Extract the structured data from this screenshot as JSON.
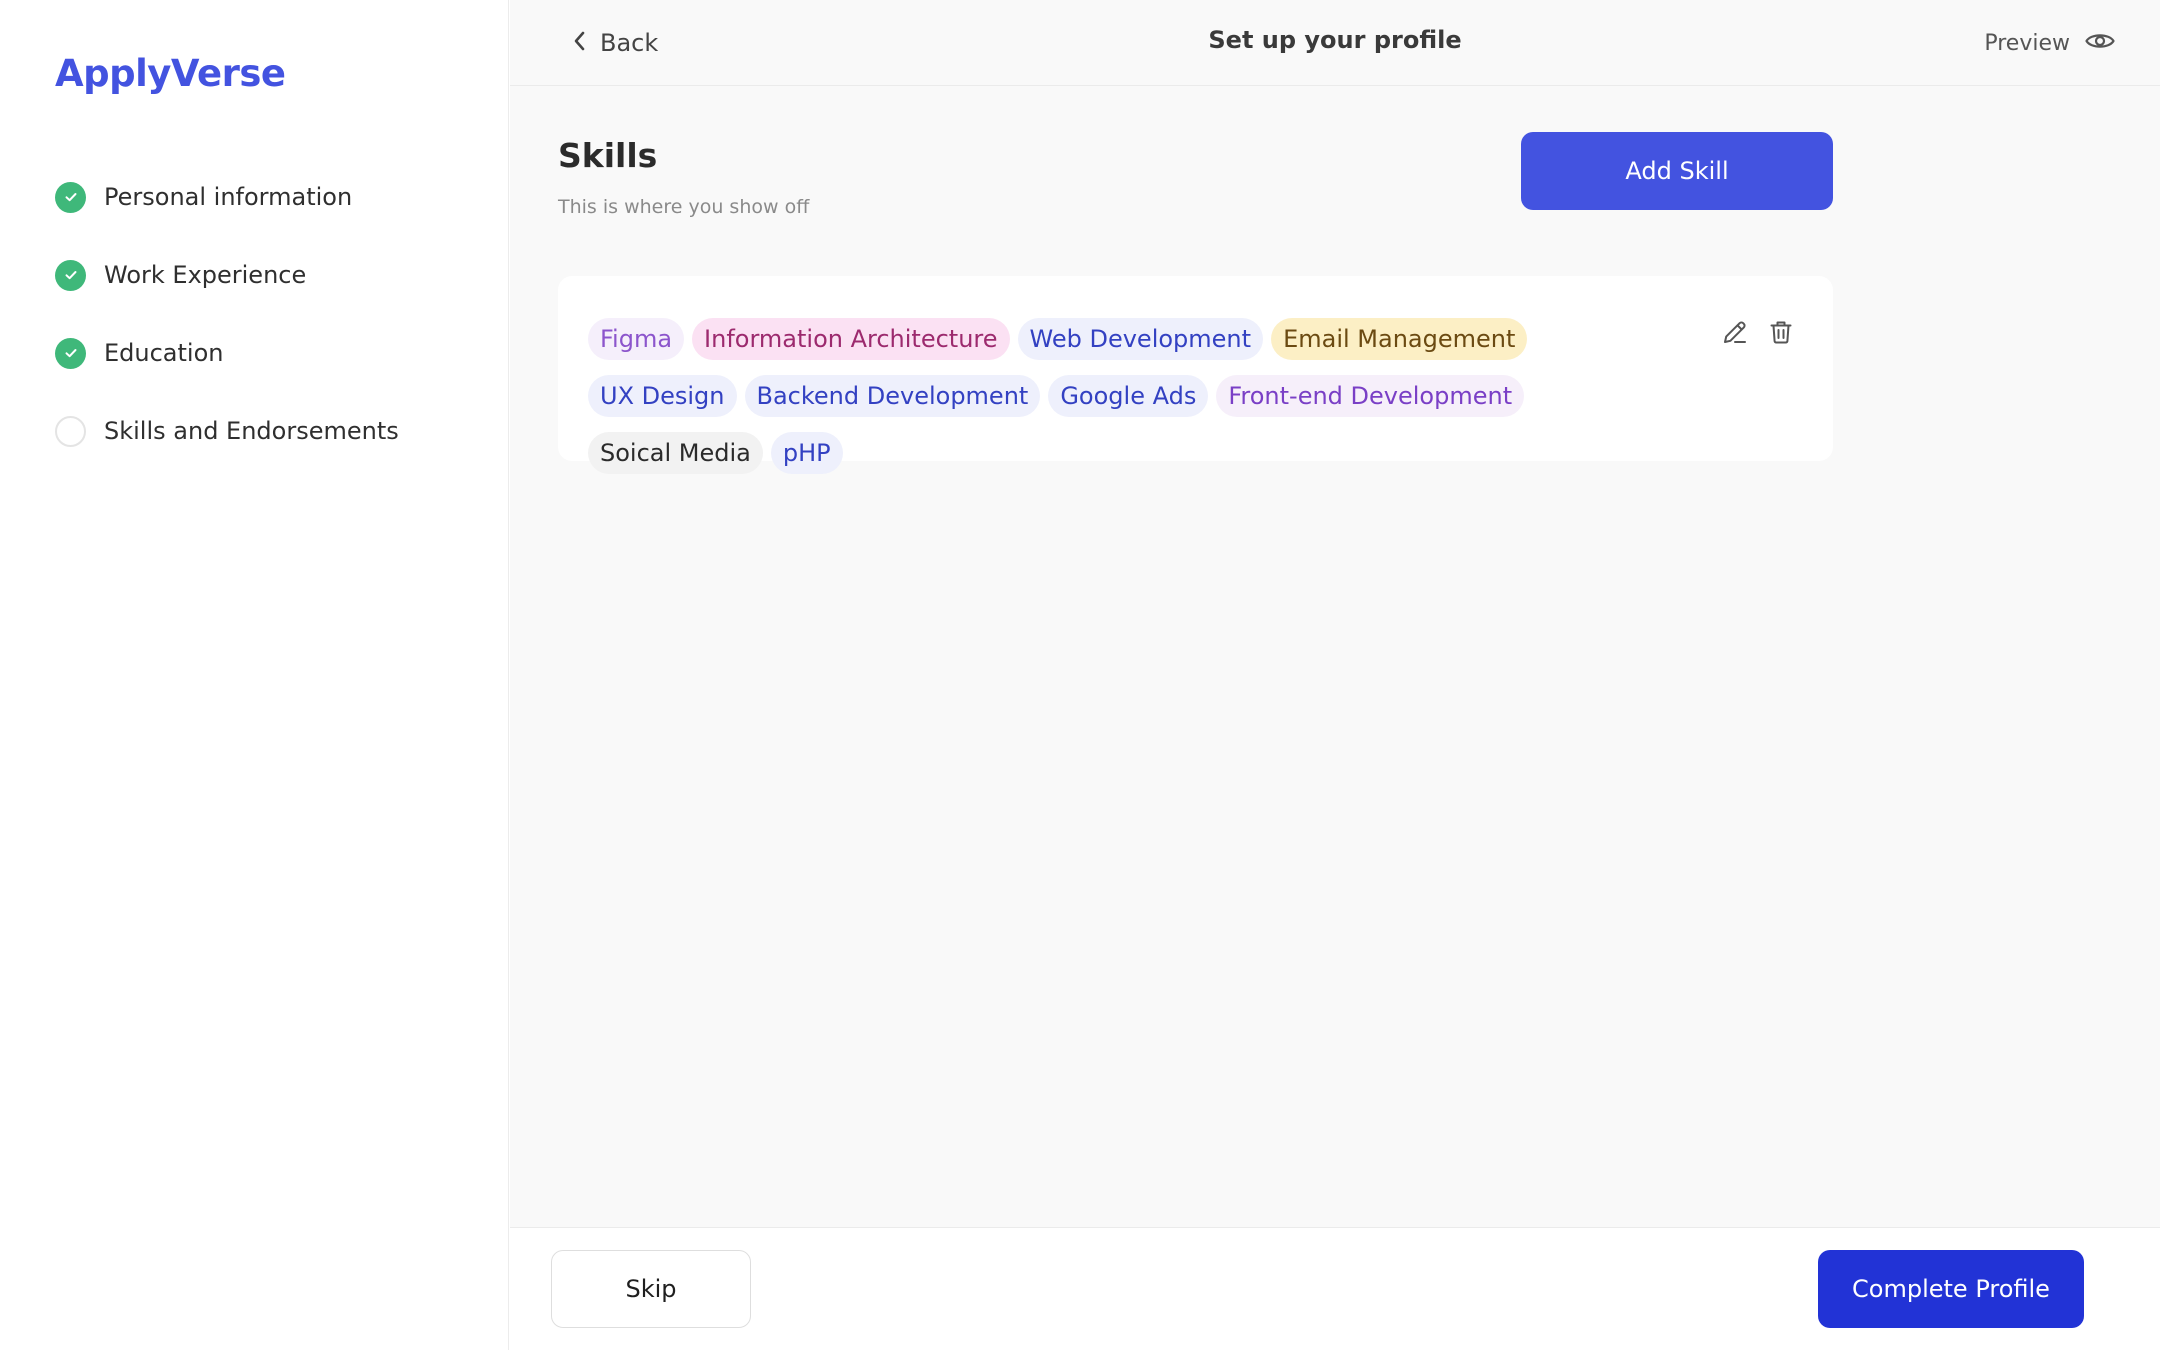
{
  "brand": {
    "name": "ApplyVerse",
    "color": "#4353e0"
  },
  "sidebar": {
    "steps": [
      {
        "label": "Personal information",
        "status": "completed",
        "icon": "check-circle-icon"
      },
      {
        "label": "Work Experience",
        "status": "completed",
        "icon": "check-circle-icon"
      },
      {
        "label": "Education",
        "status": "completed",
        "icon": "check-circle-icon"
      },
      {
        "label": "Skills and Endorsements",
        "status": "current",
        "icon": "empty-circle-icon"
      }
    ]
  },
  "header": {
    "back_label": "Back",
    "title": "Set up your profile",
    "preview_label": "Preview"
  },
  "section": {
    "title": "Skills",
    "subtitle": "This is where you show off",
    "add_button": "Add Skill"
  },
  "skills": [
    {
      "label": "Figma",
      "color": "#8c55cc"
    },
    {
      "label": "Information Architecture",
      "color": "#9c2a6e"
    },
    {
      "label": "Web Development",
      "color": "#3341c2"
    },
    {
      "label": "Email Management",
      "color": "#6b4a12"
    },
    {
      "label": "UX Design",
      "color": "#3341c2"
    },
    {
      "label": "Backend Development",
      "color": "#3341c2"
    },
    {
      "label": "Google Ads",
      "color": "#3341c2"
    },
    {
      "label": "Front-end Development",
      "color": "#7a3fc6"
    },
    {
      "label": "Soical Media",
      "color": "#2b2b2b"
    },
    {
      "label": "pHP",
      "color": "#3341c2"
    }
  ],
  "card_actions": {
    "edit_icon": "pencil-icon",
    "delete_icon": "trash-icon"
  },
  "footer": {
    "skip_label": "Skip",
    "complete_label": "Complete Profile"
  },
  "colors": {
    "accent": "#4353e0",
    "primary_button": "#2233d6",
    "success": "#3fb87a"
  }
}
